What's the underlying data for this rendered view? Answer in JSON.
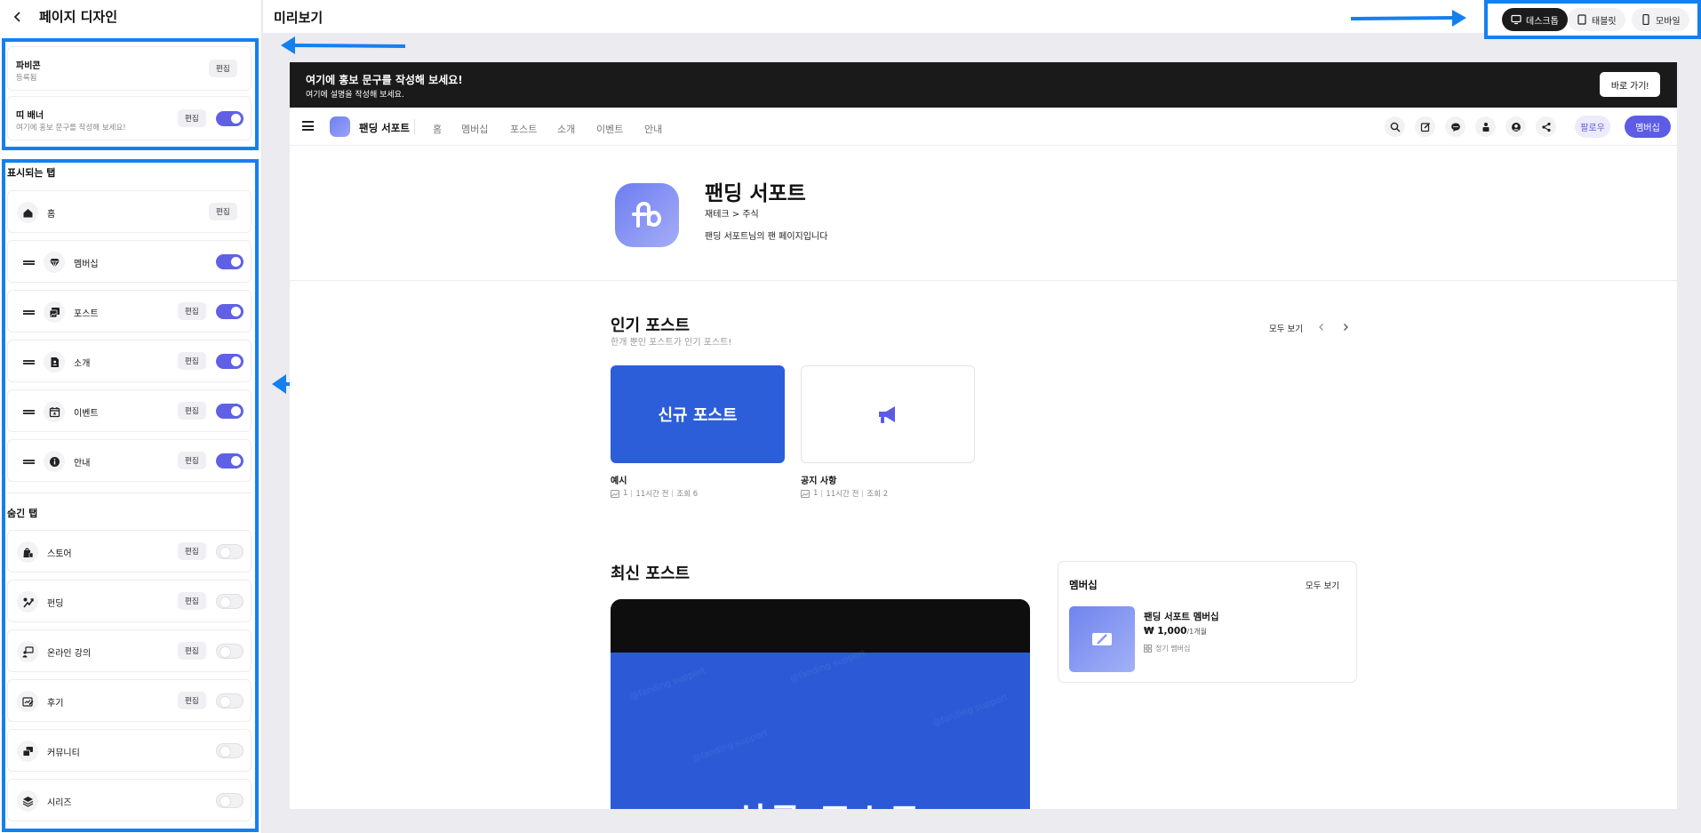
{
  "sidebar": {
    "title": "페이지 디자인",
    "favicon": {
      "label": "파비콘",
      "status": "등록됨",
      "edit": "편집"
    },
    "banner": {
      "label": "띠 배너",
      "sub": "여기에 홍보 문구를 작성해 보세요!",
      "edit": "편집",
      "enabled": true
    },
    "visible_title": "표시되는 탭",
    "visible_tabs": [
      {
        "name": "홈",
        "icon": "home-icon",
        "edit": "편집",
        "has_toggle": false,
        "draggable": false
      },
      {
        "name": "멤버십",
        "icon": "gem-icon",
        "edit": "",
        "has_toggle": true,
        "enabled": true,
        "draggable": true
      },
      {
        "name": "포스트",
        "icon": "images-icon",
        "edit": "편집",
        "has_toggle": true,
        "enabled": true,
        "draggable": true
      },
      {
        "name": "소개",
        "icon": "person-doc-icon",
        "edit": "편집",
        "has_toggle": true,
        "enabled": true,
        "draggable": true
      },
      {
        "name": "이벤트",
        "icon": "calendar-icon",
        "edit": "편집",
        "has_toggle": true,
        "enabled": true,
        "draggable": true
      },
      {
        "name": "안내",
        "icon": "info-icon",
        "edit": "편집",
        "has_toggle": true,
        "enabled": true,
        "draggable": true
      }
    ],
    "hidden_title": "숨긴 탭",
    "hidden_tabs": [
      {
        "name": "스토어",
        "icon": "store-bag-icon",
        "edit": "편집",
        "enabled": false
      },
      {
        "name": "펀딩",
        "icon": "funding-icon",
        "edit": "편집",
        "enabled": false
      },
      {
        "name": "온라인 강의",
        "icon": "lecture-icon",
        "edit": "편집",
        "enabled": false
      },
      {
        "name": "후기",
        "icon": "review-icon",
        "edit": "편집",
        "enabled": false
      },
      {
        "name": "커뮤니티",
        "icon": "community-icon",
        "edit": "",
        "enabled": false
      },
      {
        "name": "시리즈",
        "icon": "layers-icon",
        "edit": "",
        "enabled": false
      }
    ]
  },
  "topbar": {
    "title": "미리보기",
    "devices": [
      {
        "label": "데스크톱",
        "icon": "desktop-icon",
        "active": true
      },
      {
        "label": "태블릿",
        "icon": "tablet-icon",
        "active": false
      },
      {
        "label": "모바일",
        "icon": "mobile-icon",
        "active": false
      }
    ]
  },
  "preview": {
    "promo": {
      "title": "여기에 홍보 문구를 작성해 보세요!",
      "sub": "여기에 설명을 작성해 보세요.",
      "button": "바로 가기!"
    },
    "nav": {
      "brand": "팬딩 서포트",
      "links": [
        "홈",
        "멤버십",
        "포스트",
        "소개",
        "이벤트",
        "안내"
      ],
      "follow": "팔로우",
      "membership": "멤버십"
    },
    "profile": {
      "name": "팬딩 서포트",
      "category": "재테크 > 주식",
      "description": "팬딩 서포트님의 팬 페이지입니다"
    },
    "popular": {
      "title": "인기 포스트",
      "subtitle": "한개 뿐인 포스트가 인기 포스트!",
      "see_all": "모두 보기",
      "posts": [
        {
          "thumb_text": "신규 포스트",
          "title": "예시",
          "images": "1",
          "time": "11시간 전",
          "views": "조회 6"
        },
        {
          "thumb_text": "",
          "title": "공지 사항",
          "images": "1",
          "time": "11시간 전",
          "views": "조회 2"
        }
      ]
    },
    "latest": {
      "title": "최신 포스트",
      "image_text": "신규 포스트"
    },
    "membership_card": {
      "title": "멤버십",
      "see_all": "모두 보기",
      "name": "팬딩 서포트 멤버십",
      "price": "₩ 1,000",
      "price_unit": "/1개월",
      "type": "정기 멤버십"
    }
  },
  "colors": {
    "accent": "#5c5ce6",
    "annotation_blue": "#1480f0",
    "thumb_blue": "#2b5ed8"
  }
}
